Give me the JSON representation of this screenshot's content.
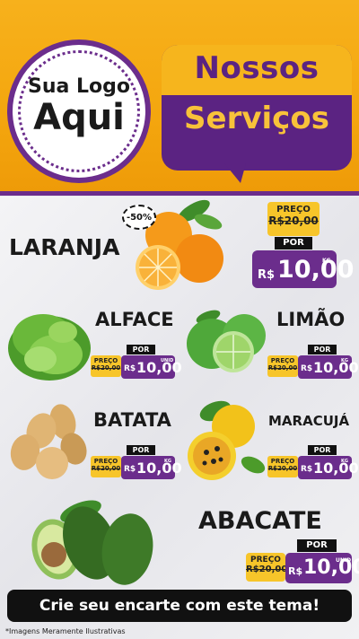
{
  "logo": {
    "line1": "Sua Logo",
    "line2": "Aqui"
  },
  "title": {
    "line1": "Nossos",
    "line2": "Serviços"
  },
  "colors": {
    "brand_purple": "#6b2d8c",
    "brand_yellow": "#f4a60e",
    "old_price_yellow": "#f7c52a"
  },
  "products": {
    "laranja": {
      "name": "LARANJA",
      "discount": "-50%",
      "old_label": "PREÇO",
      "old_price": "R$20,00",
      "new_label": "POR",
      "currency": "R$",
      "price": "10,00",
      "unit": "KG"
    },
    "alface": {
      "name": "ALFACE",
      "old_label": "PREÇO",
      "old_price": "R$20,00",
      "new_label": "POR",
      "currency": "R$",
      "price": "10,00",
      "unit": "UNID"
    },
    "limao": {
      "name": "LIMÃO",
      "old_label": "PREÇO",
      "old_price": "R$20,00",
      "new_label": "POR",
      "currency": "R$",
      "price": "10,00",
      "unit": "KG"
    },
    "batata": {
      "name": "BATATA",
      "old_label": "PREÇO",
      "old_price": "R$20,00",
      "new_label": "POR",
      "currency": "R$",
      "price": "10,00",
      "unit": "KG"
    },
    "maracuja": {
      "name": "MARACUJÁ",
      "old_label": "PREÇO",
      "old_price": "R$20,00",
      "new_label": "POR",
      "currency": "R$",
      "price": "10,00",
      "unit": "KG"
    },
    "abacate": {
      "name": "ABACATE",
      "old_label": "PREÇO",
      "old_price": "R$20,00",
      "new_label": "POR",
      "currency": "R$",
      "price": "10,00",
      "unit": "UNID"
    }
  },
  "footer": {
    "cta": "Crie seu encarte com este tema!",
    "note": "*Imagens Meramente Ilustrativas"
  }
}
